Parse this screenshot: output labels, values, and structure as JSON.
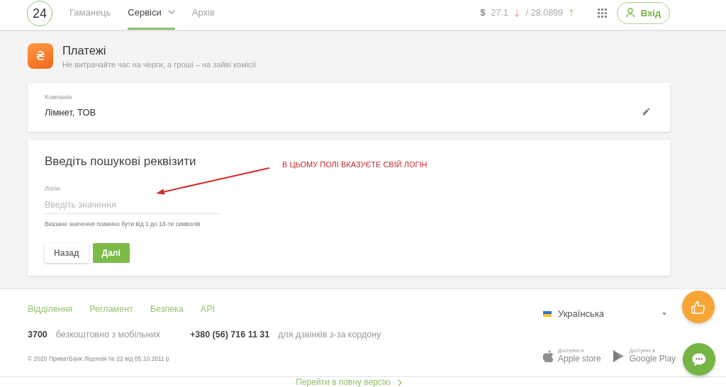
{
  "header": {
    "logo": "24",
    "nav": [
      {
        "label": "Гаманець",
        "selected": false,
        "dropdown": false
      },
      {
        "label": "Сервіси",
        "selected": true,
        "dropdown": true
      },
      {
        "label": "Архів",
        "selected": false,
        "dropdown": false
      }
    ],
    "rate": {
      "currency": "$",
      "buy": "27.1",
      "buy_rising": false,
      "sell": "/ 28.0899",
      "sell_rising": true
    },
    "login_button": "Вхід"
  },
  "page": {
    "icon": "₴",
    "title": "Платежі",
    "subtitle": "Не витрачайте час на черги, а гроші – на зайві комісії"
  },
  "company_card": {
    "label": "Компанія",
    "value": "Лімнет, ТОВ"
  },
  "search_form": {
    "title": "Введіть пошукові реквізити",
    "field": {
      "label": "Логін",
      "placeholder": "Введіть значення",
      "hint": "Вказане значення повинно бути від 1 до 18-ти символів"
    },
    "buttons": [
      {
        "label": "Назад",
        "kind": "secondary"
      },
      {
        "label": "Далі",
        "kind": "primary"
      }
    ],
    "annotation": "В ЦЬОМУ ПОЛІ ВКАЗУЄТЕ СВІЙ ЛОГІН"
  },
  "footer": {
    "links": [
      "Відділення",
      "Регламент",
      "Безпека",
      "API"
    ],
    "phones": [
      {
        "number": "3700",
        "note": "безкоштовно з мобільних"
      },
      {
        "number": "+380 (56) 716 11 31",
        "note": "для дзвінків з-за кордону"
      }
    ],
    "copyright": "© 2020 ПриватБанк Ліцензія № 22 від 05.10.2011 р",
    "language": "Українська",
    "stores": [
      {
        "kind": "apple",
        "caption": "Доступно в",
        "name": "Apple store"
      },
      {
        "kind": "google",
        "caption": "Доступно в",
        "name": "Google Play"
      }
    ]
  },
  "full_version_link": "Перейти в повну версію"
}
